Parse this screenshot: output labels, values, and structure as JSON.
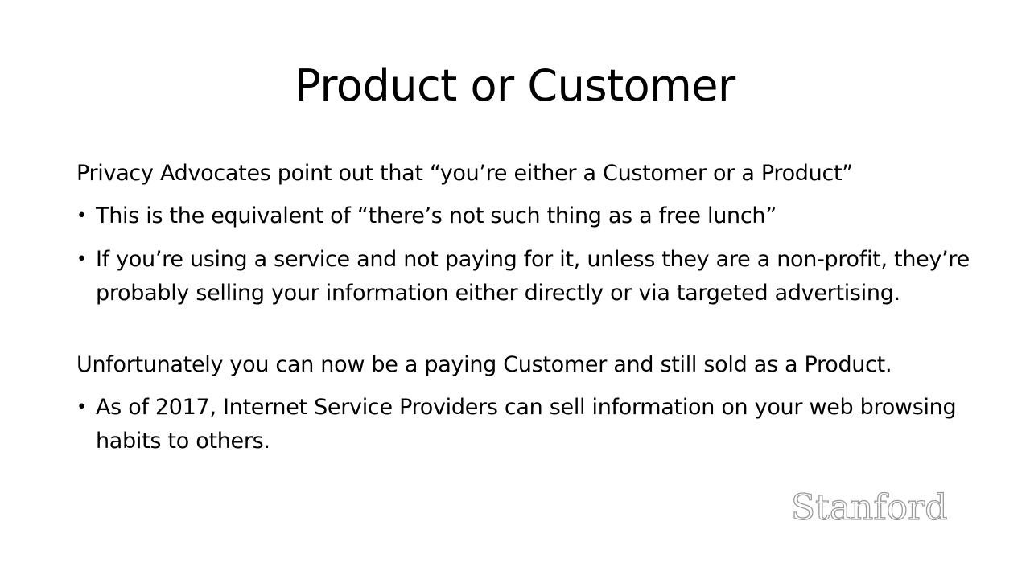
{
  "slide": {
    "title": "Product or Customer",
    "section1": {
      "lead": "Privacy Advocates point out that “you’re either a Customer or a Product”",
      "bullets": [
        "This is the equivalent of “there’s not such thing as a free lunch”",
        "If you’re using a service and not paying for it, unless they are a non-profit, they’re probably selling your information either directly or via targeted advertising."
      ]
    },
    "section2": {
      "lead": "Unfortunately you can now be a paying Customer and still sold as a Product.",
      "bullets": [
        "As of 2017, Internet Service Providers can sell information on your web browsing habits to others."
      ]
    },
    "bullet_glyph": "•",
    "logo_text": "Stanford"
  }
}
